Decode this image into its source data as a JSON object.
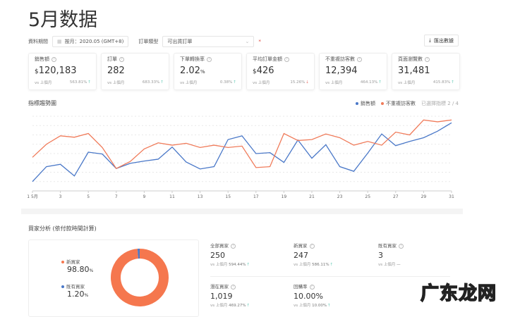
{
  "title": "5月数据",
  "filters": {
    "period_label": "資料期間",
    "period_value": "按月：2020.05 (GMT+8)",
    "order_type_label": "訂單類型",
    "order_type_value": "可出貨訂單",
    "required_mark": "*",
    "export_label": "匯出數據"
  },
  "cards": [
    {
      "label": "銷售額",
      "currency": "$",
      "value": "120,183",
      "unit": "",
      "compare": "vs 上個月",
      "change": "563.81%",
      "trend": "up"
    },
    {
      "label": "訂單",
      "currency": "",
      "value": "282",
      "unit": "",
      "compare": "vs 上個月",
      "change": "683.33%",
      "trend": "up"
    },
    {
      "label": "下單轉換率",
      "currency": "",
      "value": "2.02",
      "unit": "%",
      "compare": "vs 上個月",
      "change": "0.38%",
      "trend": "up"
    },
    {
      "label": "平均訂單金額",
      "currency": "$",
      "value": "426",
      "unit": "",
      "compare": "vs 上個月",
      "change": "15.26%",
      "trend": "down"
    },
    {
      "label": "不重複訪客數",
      "currency": "",
      "value": "12,394",
      "unit": "",
      "compare": "vs 上個月",
      "change": "464.13%",
      "trend": "up"
    },
    {
      "label": "頁面瀏覽數",
      "currency": "",
      "value": "31,481",
      "unit": "",
      "compare": "vs 上個月",
      "change": "415.83%",
      "trend": "up"
    }
  ],
  "trend": {
    "title": "指標趨勢圖",
    "selected": "已選擇指標 2 / 4"
  },
  "chart_data": {
    "type": "line",
    "x": [
      1,
      2,
      3,
      4,
      5,
      6,
      7,
      8,
      9,
      10,
      11,
      12,
      13,
      14,
      15,
      16,
      17,
      18,
      19,
      20,
      21,
      22,
      23,
      24,
      25,
      26,
      27,
      28,
      29,
      30,
      31
    ],
    "xticks": [
      "1 5月",
      "3",
      "5",
      "7",
      "9",
      "11",
      "13",
      "15",
      "17",
      "19",
      "21",
      "23",
      "25",
      "27",
      "29",
      "31"
    ],
    "ylim": [
      0,
      8
    ],
    "grid": true,
    "legend": "top-right",
    "series": [
      {
        "name": "銷售額",
        "color": "#4a78c8",
        "values": [
          1.0,
          2.6,
          2.85,
          1.6,
          4.15,
          3.95,
          2.4,
          2.95,
          3.2,
          3.4,
          4.7,
          3.1,
          2.35,
          2.6,
          5.5,
          5.9,
          4.0,
          4.1,
          3.05,
          5.45,
          3.5,
          4.95,
          2.6,
          2.1,
          4.05,
          6.1,
          4.85,
          5.3,
          5.7,
          6.4,
          7.3
        ]
      },
      {
        "name": "不重複訪客數",
        "color": "#f07b5a",
        "values": [
          3.6,
          5.0,
          5.9,
          5.75,
          6.15,
          4.65,
          2.4,
          3.15,
          4.5,
          5.15,
          4.9,
          5.1,
          4.65,
          4.9,
          4.65,
          4.8,
          2.5,
          2.6,
          6.15,
          5.4,
          5.5,
          6.1,
          5.7,
          4.9,
          5.3,
          4.9,
          6.3,
          6.0,
          7.6,
          7.4,
          7.6
        ]
      }
    ]
  },
  "buyers": {
    "title": "買家分析 (依付款時間計算)",
    "pie": [
      {
        "label": "新買家",
        "value": "98.80",
        "pct": 98.8,
        "color": "#f5774e"
      },
      {
        "label": "既有買家",
        "value": "1.20",
        "pct": 1.2,
        "color": "#4a78c8"
      }
    ],
    "unit": "%",
    "stats": [
      {
        "label": "全部買家",
        "value": "250",
        "compare": "vs 上個月",
        "change": "594.44%",
        "trend": "up"
      },
      {
        "label": "新買家",
        "value": "247",
        "compare": "vs 上個月",
        "change": "586.11%",
        "trend": "up"
      },
      {
        "label": "既有買家",
        "value": "3",
        "compare": "vs 上個月",
        "change": "—",
        "trend": ""
      },
      {
        "label": "潛在買家",
        "value": "1,019",
        "compare": "vs 上個月",
        "change": "469.27%",
        "trend": "up"
      },
      {
        "label": "回購率",
        "value": "10.00%",
        "compare": "vs 上個月",
        "change": "10.00%",
        "trend": "up"
      }
    ]
  },
  "watermark": "广东龙网"
}
